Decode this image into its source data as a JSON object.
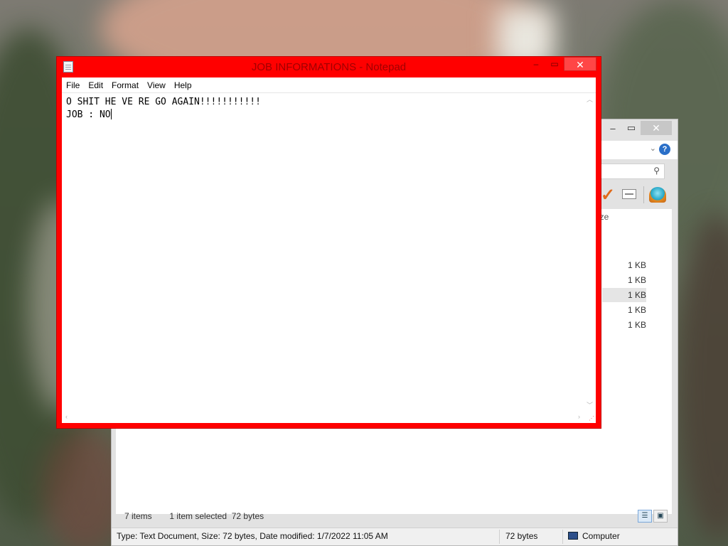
{
  "notepad": {
    "title": "JOB INFORMATIONS - Notepad",
    "menu": [
      "File",
      "Edit",
      "Format",
      "View",
      "Help"
    ],
    "text_lines": [
      "O SHIT HE VE RE GO AGAIN!!!!!!!!!!!",
      "JOB : NO"
    ],
    "controls": {
      "minimize": "–",
      "maximize": "▭",
      "close": "✕"
    }
  },
  "explorer": {
    "controls": {
      "minimize": "–",
      "maximize": "▭",
      "close": "✕"
    },
    "size_column_header_partial": "ize",
    "file_sizes": [
      "1 KB",
      "1 KB",
      "1 KB",
      "1 KB",
      "1 KB"
    ],
    "selected_row_index": 2,
    "status": {
      "items": "7 items",
      "selection": "1 item selected  72 bytes"
    },
    "details_bar": {
      "info": "Type: Text Document, Size: 72 bytes, Date modified: 1/7/2022 11:05 AM",
      "size": "72 bytes",
      "location": "Computer"
    }
  },
  "colors": {
    "notepad_frame": "#ff0000",
    "title_text": "#a00000",
    "close_button": "#ff4646"
  }
}
